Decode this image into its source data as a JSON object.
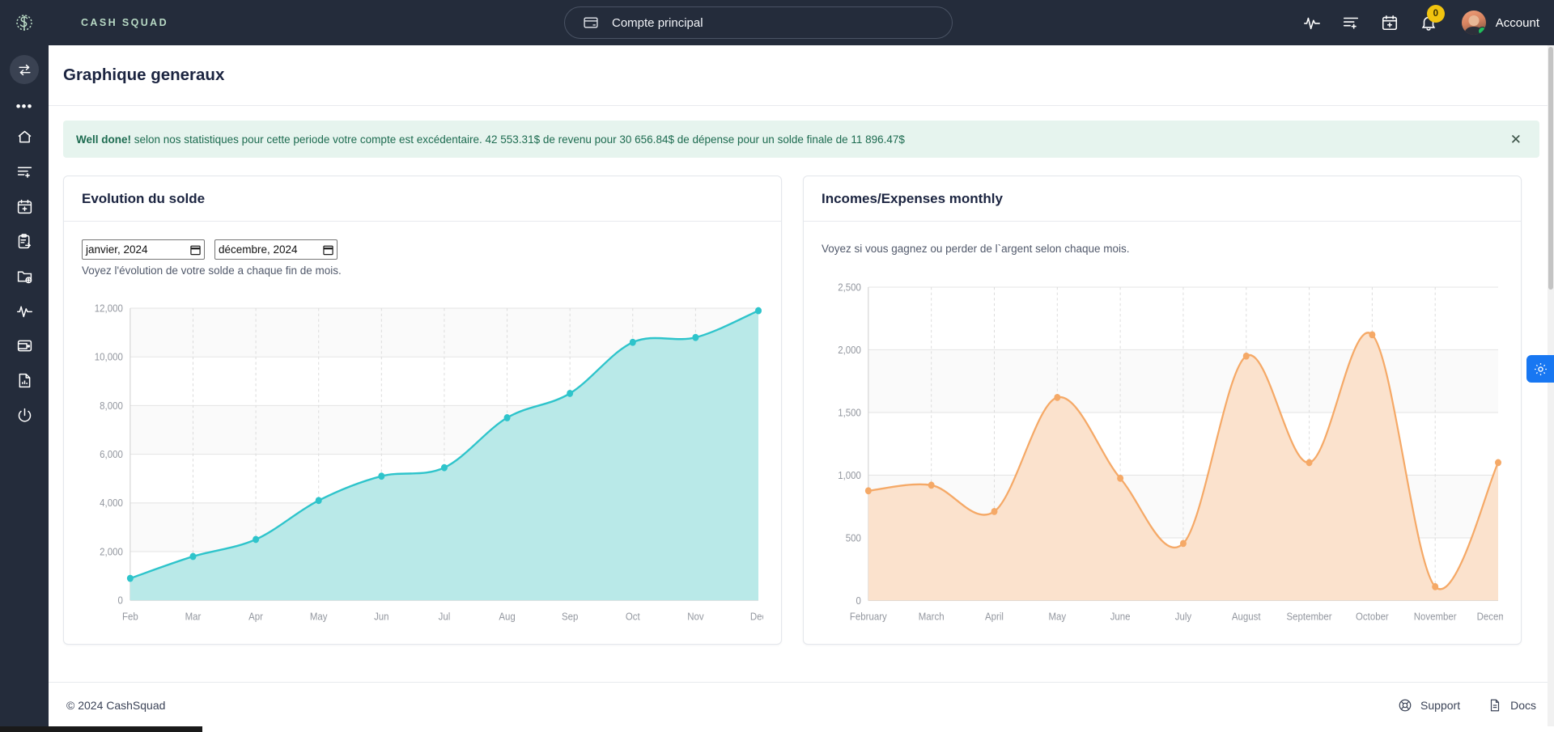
{
  "brand": {
    "name": "CASH SQUAD",
    "logo_icon": "squad-monogram-icon"
  },
  "topbar": {
    "account_selector": {
      "label": "Compte principal",
      "icon": "card-icon"
    },
    "icons": [
      {
        "name": "activity-pulse-icon"
      },
      {
        "name": "list-add-icon"
      },
      {
        "name": "calendar-add-icon"
      }
    ],
    "notifications": {
      "icon": "bell-icon",
      "count": "0"
    },
    "account": {
      "label": "Account",
      "avatar_icon": "user-avatar",
      "status": "online"
    }
  },
  "sidebar": {
    "toggle": {
      "icon": "swap-arrows-icon"
    },
    "more": {
      "icon": "ellipsis-icon"
    },
    "items": [
      {
        "icon": "home-icon",
        "name": "home"
      },
      {
        "icon": "list-add-icon",
        "name": "transactions-add"
      },
      {
        "icon": "calendar-add-icon",
        "name": "calendar-add"
      },
      {
        "icon": "clipboard-import-icon",
        "name": "clipboard"
      },
      {
        "icon": "folder-add-icon",
        "name": "folder-add"
      },
      {
        "icon": "activity-pulse-icon",
        "name": "activity"
      },
      {
        "icon": "wallet-icon",
        "name": "wallet"
      },
      {
        "icon": "document-chart-icon",
        "name": "reports"
      },
      {
        "icon": "power-icon",
        "name": "logout"
      }
    ]
  },
  "page": {
    "title": "Graphique generaux"
  },
  "alert": {
    "strong": "Well done!",
    "text": " selon nos statistiques pour cette periode votre compte est excédentaire. 42 553.31$ de revenu pour 30 656.84$ de dépense pour un solde finale de 11 896.47$",
    "close_icon": "close-icon",
    "bg_color": "#e6f4ee",
    "text_color": "#1d6b50"
  },
  "cards": {
    "balance": {
      "title": "Evolution du solde",
      "date_from": {
        "value": "janvier, 2024",
        "icon": "calendar-picker-icon"
      },
      "date_to": {
        "value": "décembre, 2024",
        "icon": "calendar-picker-icon"
      },
      "subtitle": "Voyez l'évolution de votre solde a chaque fin de mois."
    },
    "incomes": {
      "title": "Incomes/Expenses monthly",
      "subtitle": "Voyez si vous gagnez ou perder de l`argent selon chaque mois."
    }
  },
  "footer": {
    "copyright": "© 2024 CashSquad",
    "links": [
      {
        "label": "Support",
        "icon": "lifebuoy-icon"
      },
      {
        "label": "Docs",
        "icon": "document-icon"
      }
    ]
  },
  "settings_fab": {
    "icon": "gear-icon",
    "color": "#1877f2"
  },
  "chart_data": [
    {
      "type": "area",
      "id": "balance-evolution",
      "title": "Evolution du solde",
      "categories": [
        "Feb",
        "Mar",
        "Apr",
        "May",
        "Jun",
        "Jul",
        "Aug",
        "Sep",
        "Oct",
        "Nov",
        "Dec"
      ],
      "values": [
        900,
        1800,
        2500,
        4100,
        5100,
        5450,
        7500,
        8500,
        10600,
        10800,
        11900
      ],
      "ylim": [
        0,
        12000
      ],
      "yticks": [
        0,
        2000,
        4000,
        6000,
        8000,
        10000,
        12000
      ],
      "ytick_labels": [
        "0",
        "2,000",
        "4,000",
        "6,000",
        "8,000",
        "10,000",
        "12,000"
      ],
      "xlabel": "",
      "ylabel": "",
      "grid": true,
      "legend": "none",
      "line_color": "#2ec4cb",
      "fill_color": "#b9e9e8"
    },
    {
      "type": "area",
      "id": "incomes-expenses-monthly",
      "title": "Incomes/Expenses monthly",
      "categories": [
        "February",
        "March",
        "April",
        "May",
        "June",
        "July",
        "August",
        "September",
        "October",
        "November",
        "December"
      ],
      "values": [
        875,
        920,
        710,
        1620,
        975,
        455,
        1950,
        1100,
        2120,
        110,
        1100
      ],
      "ylim": [
        0,
        2500
      ],
      "yticks": [
        0,
        500,
        1000,
        1500,
        2000,
        2500
      ],
      "ytick_labels": [
        "0",
        "500",
        "1,000",
        "1,500",
        "2,000",
        "2,500"
      ],
      "xlabel": "",
      "ylabel": "",
      "grid": true,
      "legend": "none",
      "line_color": "#f5a967",
      "fill_color": "#fbe2cd"
    }
  ]
}
